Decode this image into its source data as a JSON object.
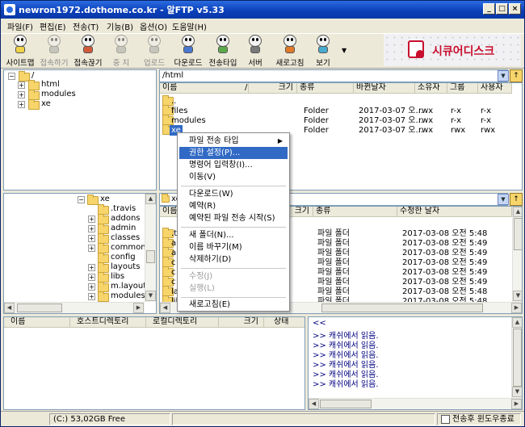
{
  "window": {
    "title": "newron1972.dothome.co.kr - 알FTP v5.33"
  },
  "menu": [
    "파일(F)",
    "편집(E)",
    "전송(T)",
    "기능(B)",
    "옵션(O)",
    "도움말(H)"
  ],
  "toolbar": [
    {
      "label": "사이트맵",
      "enabled": true
    },
    {
      "label": "접속하기",
      "enabled": false
    },
    {
      "label": "접속끊기",
      "enabled": true
    },
    {
      "label": "중 지",
      "enabled": false
    },
    {
      "label": "업로드",
      "enabled": false
    },
    {
      "label": "다운로드",
      "enabled": true
    },
    {
      "label": "전송타입",
      "enabled": true
    },
    {
      "label": "서버",
      "enabled": true
    },
    {
      "label": "새로고침",
      "enabled": true
    },
    {
      "label": "보기",
      "enabled": true
    }
  ],
  "brand": {
    "text": "시큐어디스크"
  },
  "remote_tree": {
    "root": "/",
    "items": [
      "html",
      "modules",
      "xe"
    ]
  },
  "remote_path": "/html",
  "remote_columns": [
    "이름",
    "/",
    "크기",
    "종류",
    "바뀐날자",
    "소유자",
    "그룹",
    "사용자"
  ],
  "remote_files": [
    {
      "name": "..",
      "type": "",
      "date": "",
      "owner": "",
      "group": "",
      "user": ""
    },
    {
      "name": "files",
      "type": "Folder",
      "date": "2017-03-07 오...",
      "owner": "rwx",
      "group": "r-x",
      "user": "r-x"
    },
    {
      "name": "modules",
      "type": "Folder",
      "date": "2017-03-07 오...",
      "owner": "rwx",
      "group": "r-x",
      "user": "r-x"
    },
    {
      "name": "xe",
      "type": "Folder",
      "date": "2017-03-07 오...",
      "owner": "rwx",
      "group": "rwx",
      "user": "rwx"
    }
  ],
  "local_tree": {
    "root": "xe",
    "items": [
      ".travis",
      "addons",
      "admin",
      "classes",
      "common",
      "config",
      "layouts",
      "libs",
      "m.layouts",
      "modules"
    ]
  },
  "local_path": "xe",
  "local_columns": [
    "이름",
    "크기",
    "종류",
    "수정한 날자"
  ],
  "local_files": [
    {
      "name": ".t",
      "type": "파일 폴더",
      "date": "2017-03-08 오전 5:48"
    },
    {
      "name": "a",
      "type": "파일 폴더",
      "date": "2017-03-08 오전 5:49"
    },
    {
      "name": "a",
      "type": "파일 폴더",
      "date": "2017-03-08 오전 5:49"
    },
    {
      "name": "c",
      "type": "파일 폴더",
      "date": "2017-03-08 오전 5:49"
    },
    {
      "name": "c",
      "type": "파일 폴더",
      "date": "2017-03-08 오전 5:49"
    },
    {
      "name": "c",
      "type": "파일 폴더",
      "date": "2017-03-08 오전 5:49"
    },
    {
      "name": "la",
      "type": "파일 폴더",
      "date": "2017-03-08 오전 5:48"
    },
    {
      "name": "lil",
      "type": "파일 폴더",
      "date": "2017-03-08 오전 5:48"
    }
  ],
  "context_menu": [
    {
      "label": "파일 전송 타입",
      "state": "normal",
      "submenu": true
    },
    {
      "label": "권한 설정(P)...",
      "state": "highlight"
    },
    {
      "label": "명령어 입력창(I)...",
      "state": "normal"
    },
    {
      "label": "이동(V)",
      "state": "normal"
    },
    {
      "label": "다운로드(W)",
      "state": "normal"
    },
    {
      "label": "예약(R)",
      "state": "normal"
    },
    {
      "label": "예약된 파일 전송 시작(S)",
      "state": "normal"
    },
    {
      "label": "새 폴더(N)...",
      "state": "normal"
    },
    {
      "label": "이름 바꾸기(M)",
      "state": "normal"
    },
    {
      "label": "삭제하기(D)",
      "state": "normal"
    },
    {
      "label": "수정(J)",
      "state": "disabled"
    },
    {
      "label": "실행(L)",
      "state": "disabled"
    },
    {
      "label": "새로고침(E)",
      "state": "normal"
    }
  ],
  "queue_columns": [
    "이름",
    "호스트디렉토리",
    "로컬디렉토리",
    "크기",
    "상태"
  ],
  "log": [
    "<<",
    ">> 캐쉬에서 읽음.",
    ">> 캐쉬에서 읽음.",
    ">> 캐쉬에서 읽음.",
    ">> 캐쉬에서 읽음.",
    ">> 캐쉬에서 읽음.",
    ">> 캐쉬에서 읽음."
  ],
  "status": {
    "drive": "(C:)  53,02GB Free",
    "checkbox_label": "전송후 윈도우종료"
  }
}
